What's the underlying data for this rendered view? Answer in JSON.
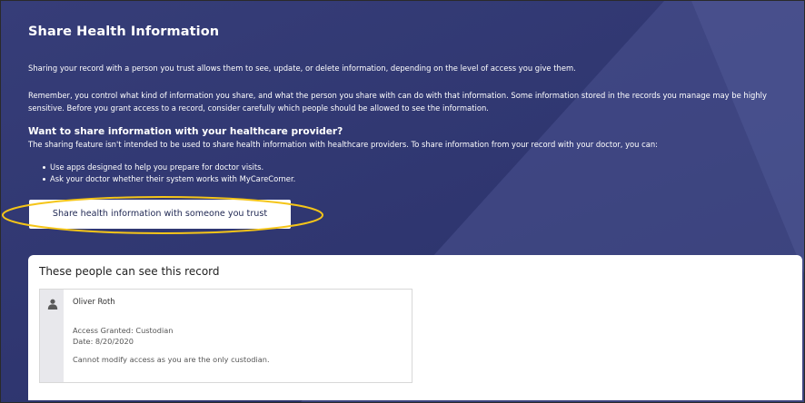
{
  "colors": {
    "banner_bg": "#2d3468",
    "highlight_ring": "#f5c518",
    "button_text": "#222a55",
    "card_bg": "#ffffff"
  },
  "banner": {
    "title": "Share Health Information",
    "intro": "Sharing your record with a person you trust allows them to see, update, or delete information, depending on the level of access you give them.",
    "remember": "Remember, you control what kind of information you share, and what the person you share with can do with that information. Some information stored in the records you manage may be highly sensitive. Before you grant access to a record, consider carefully which people should be allowed to see the information.",
    "provider_heading": "Want to share information with your healthcare provider?",
    "provider_text": "The sharing feature isn't intended to be used to share health information with healthcare providers. To share information from your record with your doctor, you can:",
    "bullets": [
      "Use apps designed to help you prepare for doctor visits.",
      "Ask your doctor whether their system works with MyCareCorner."
    ],
    "share_button_label": "Share health information with someone you trust"
  },
  "access_card": {
    "title": "These people can see this record",
    "people": [
      {
        "icon": "person-icon",
        "name": "Oliver Roth",
        "access": "Access Granted: Custodian",
        "date": "Date: 8/20/2020",
        "note": "Cannot modify access as you are the only custodian."
      }
    ]
  }
}
